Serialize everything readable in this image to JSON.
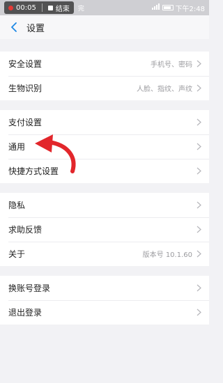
{
  "status_bar": {
    "recording_time": "00:05",
    "stop_label": "结束",
    "carrier_fragment": "完",
    "battery_level": "",
    "clock": "下午2:48"
  },
  "header": {
    "title": "设置"
  },
  "groups": [
    {
      "items": [
        {
          "label": "安全设置",
          "value": "手机号、密码"
        },
        {
          "label": "生物识别",
          "value": "人脸、指纹、声纹"
        }
      ]
    },
    {
      "items": [
        {
          "label": "支付设置",
          "value": ""
        },
        {
          "label": "通用",
          "value": ""
        },
        {
          "label": "快捷方式设置",
          "value": ""
        }
      ]
    },
    {
      "items": [
        {
          "label": "隐私",
          "value": ""
        },
        {
          "label": "求助反馈",
          "value": ""
        },
        {
          "label": "关于",
          "value": "版本号 10.1.60"
        }
      ]
    },
    {
      "items": [
        {
          "label": "换账号登录",
          "value": ""
        },
        {
          "label": "退出登录",
          "value": ""
        }
      ]
    }
  ],
  "colors": {
    "background": "#f2f2f5",
    "accent": "#1e88e5",
    "annotation_arrow": "#e2262b"
  }
}
